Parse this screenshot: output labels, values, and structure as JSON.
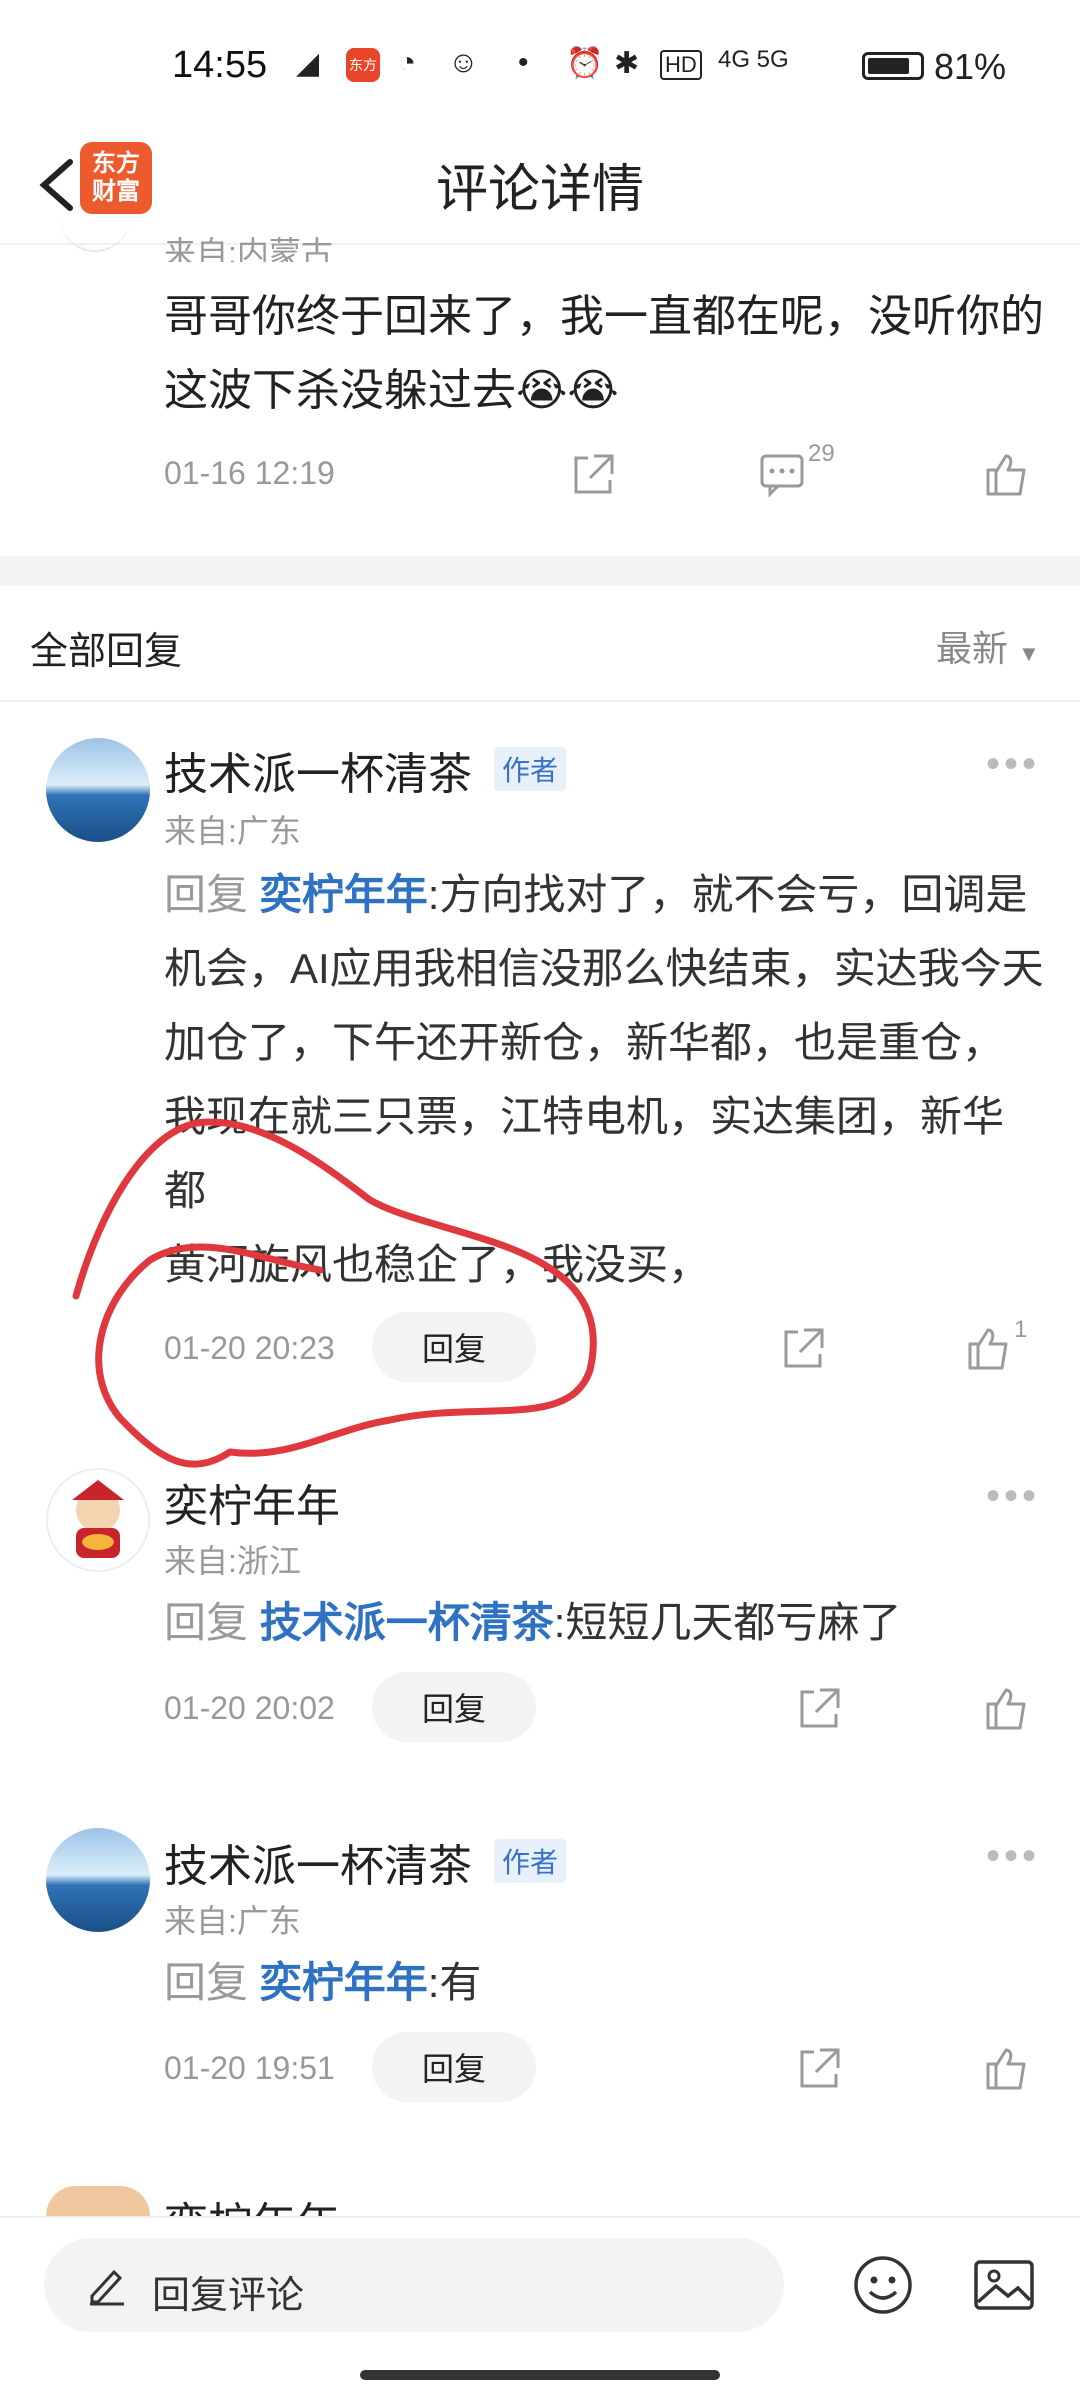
{
  "status_bar": {
    "time": "14:55",
    "network": "4G 5G",
    "hd": "HD",
    "battery_pct": "81%",
    "battery_level": 0.81,
    "app_badge": "东方\n证券"
  },
  "header": {
    "title": "评论详情",
    "logo_line1": "东方",
    "logo_line2": "财富"
  },
  "top_comment": {
    "from": "来自:内蒙古",
    "text": "哥哥你终于回来了，我一直都在呢，没听你的这波下杀没躲过去😭😭",
    "time": "01-16 12:19",
    "comment_count": "29"
  },
  "replies_section": {
    "title": "全部回复",
    "sort": "最新"
  },
  "replies": [
    {
      "name": "技术派一杯清茶",
      "tag": "作者",
      "from": "来自:广东",
      "reply_prefix": "回复",
      "mention": "奕柠年年",
      "text": ":方向找对了，就不会亏，回调是机会，AI应用我相信没那么快结束，实达我今天加仓了，下午还开新仓，新华都，也是重仓，我现在就三只票，江特电机，实达集团，新华都",
      "text2": "黄河旋风也稳企了，我没买，",
      "time": "01-20 20:23",
      "reply_label": "回复",
      "likes": "1"
    },
    {
      "name": "奕柠年年",
      "from": "来自:浙江",
      "reply_prefix": "回复",
      "mention": "技术派一杯清茶",
      "text": ":短短几天都亏麻了",
      "time": "01-20 20:02",
      "reply_label": "回复"
    },
    {
      "name": "技术派一杯清茶",
      "tag": "作者",
      "from": "来自:广东",
      "reply_prefix": "回复",
      "mention": "奕柠年年",
      "text": ":有",
      "time": "01-20 19:51",
      "reply_label": "回复"
    },
    {
      "name": "奕柠年年"
    }
  ],
  "bottom_bar": {
    "placeholder": "回复评论"
  }
}
